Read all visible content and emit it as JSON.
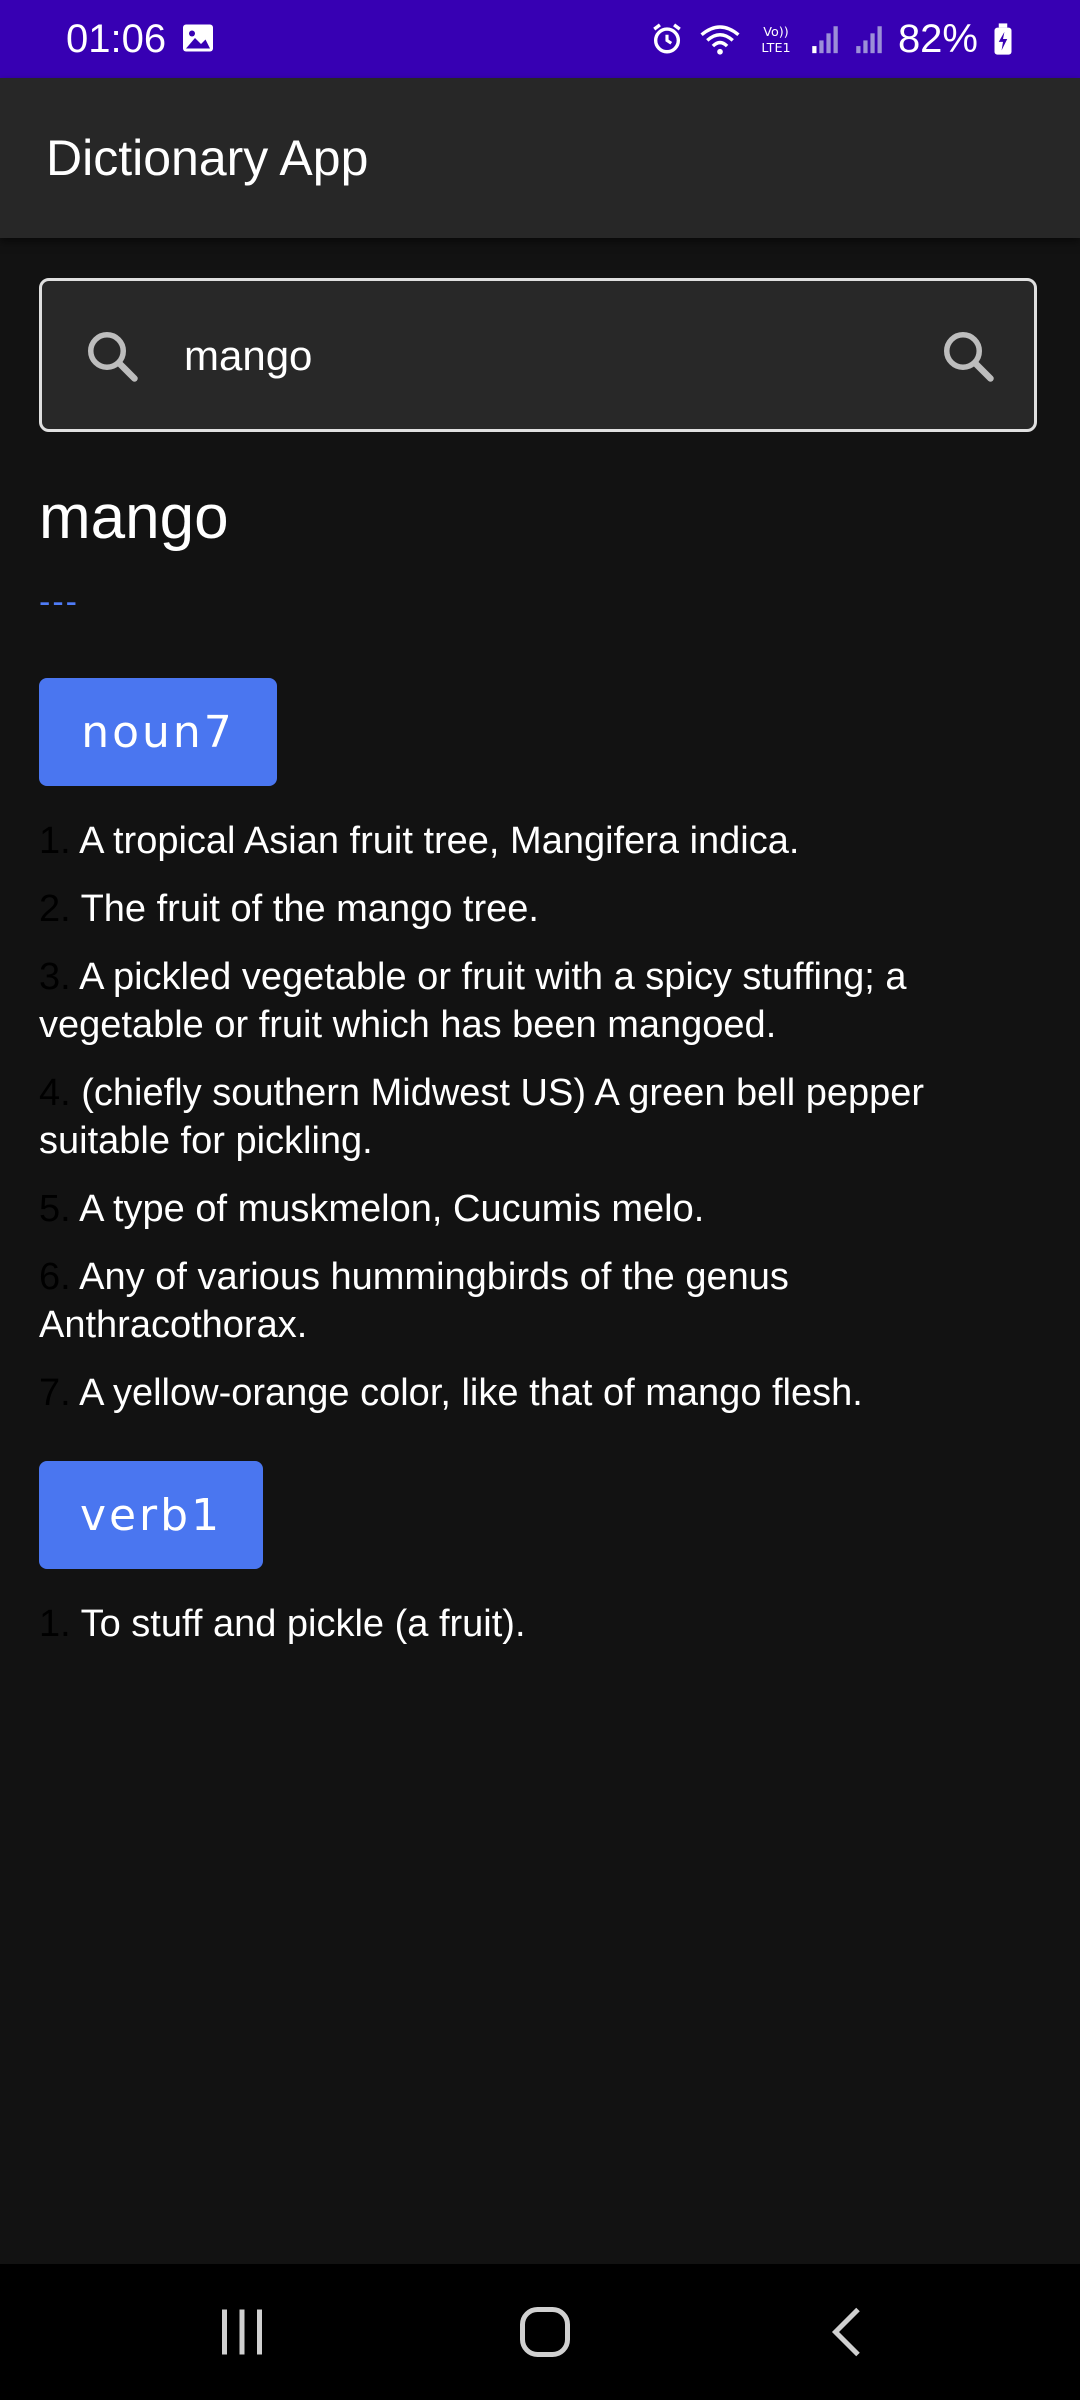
{
  "status_bar": {
    "time": "01:06",
    "battery": "82%",
    "left_icons": [
      "gallery-icon"
    ],
    "right_icons": [
      "alarm-icon",
      "wifi-icon",
      "volte-icon",
      "signal-icon",
      "signal-icon",
      "battery-charging-icon"
    ]
  },
  "app_bar": {
    "title": "Dictionary App"
  },
  "search": {
    "value": "mango",
    "leading_icon": "search-icon",
    "trailing_icon": "search-icon"
  },
  "result": {
    "word": "mango",
    "phonetic": "---",
    "sections": [
      {
        "part_of_speech": "noun7",
        "definitions": [
          {
            "num": "1.",
            "text": "A tropical Asian fruit tree, Mangifera indica."
          },
          {
            "num": "2.",
            "text": "The fruit of the mango tree."
          },
          {
            "num": "3.",
            "text": "A pickled vegetable or fruit with a spicy stuffing; a vegetable or fruit which has been mangoed."
          },
          {
            "num": "4.",
            "text": "(chiefly southern Midwest US) A green bell pepper suitable for pickling."
          },
          {
            "num": "5.",
            "text": "A type of muskmelon, Cucumis melo."
          },
          {
            "num": "6.",
            "text": "Any of various hummingbirds of the genus Anthracothorax."
          },
          {
            "num": "7.",
            "text": "A yellow-orange color, like that of mango flesh."
          }
        ]
      },
      {
        "part_of_speech": "verb1",
        "definitions": [
          {
            "num": "1.",
            "text": "To stuff and pickle (a fruit)."
          }
        ]
      }
    ]
  },
  "colors": {
    "status_bar": "#3700b3",
    "app_bar": "#272727",
    "background": "#121212",
    "chip": "#4a76f0",
    "phonetic": "#4f7cf7"
  },
  "nav_bar": {
    "buttons": [
      "recents-icon",
      "home-icon",
      "back-icon"
    ]
  }
}
